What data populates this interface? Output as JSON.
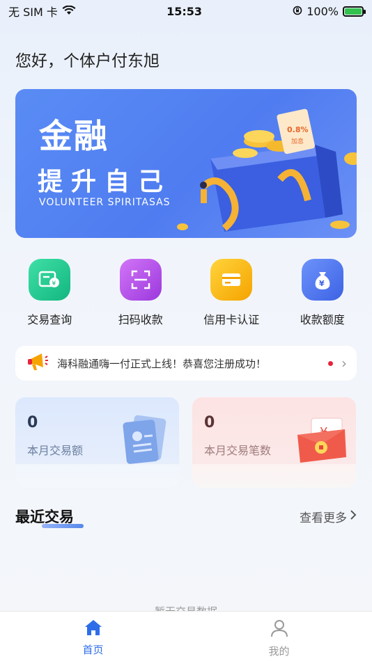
{
  "status_bar": {
    "carrier": "无 SIM 卡",
    "time": "15:53",
    "battery": "100%"
  },
  "greeting": "您好，个体户付东旭",
  "banner": {
    "title": "金融",
    "subtitle": "提升自己",
    "english": "VOLUNTEER SPIRITASAS",
    "badge_rate": "0.8%",
    "badge_text": "加息"
  },
  "quick_menu": [
    {
      "label": "交易查询",
      "icon": "transaction-query-icon",
      "color": "#19c58a"
    },
    {
      "label": "扫码收款",
      "icon": "scan-collect-icon",
      "color": "#b24de8"
    },
    {
      "label": "信用卡认证",
      "icon": "credit-card-icon",
      "color": "#f7b500"
    },
    {
      "label": "收款额度",
      "icon": "money-bag-icon",
      "color": "#4a72ee"
    }
  ],
  "notice": {
    "text": "海科融通嗨一付正式上线！恭喜您注册成功！"
  },
  "stats": {
    "monthly_amount": {
      "value": "0",
      "label": "本月交易额"
    },
    "monthly_count": {
      "value": "0",
      "label": "本月交易笔数"
    }
  },
  "recent": {
    "title": "最近交易",
    "more": "查看更多"
  },
  "empty_text": "暂无交易数据",
  "tabs": [
    {
      "label": "首页",
      "icon": "home-icon",
      "active": true
    },
    {
      "label": "我的",
      "icon": "user-icon",
      "active": false
    }
  ],
  "colors": {
    "accent": "#2d6de8",
    "banner_bg": "#5a8cf5"
  }
}
